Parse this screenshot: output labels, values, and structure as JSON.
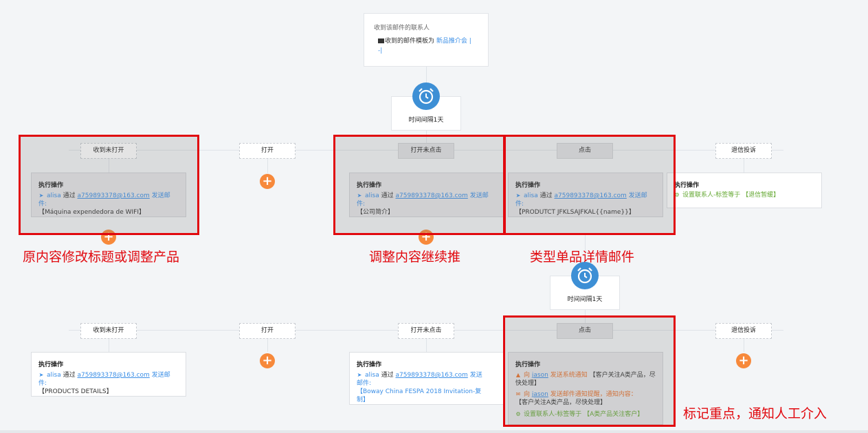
{
  "start": {
    "title": "收到该邮件的联系人",
    "template_prefix": "收到的邮件模板为",
    "template_name": "新品推介会 | -|"
  },
  "timers": [
    {
      "label": "时间间隔1天",
      "icon": "alarm-clock-icon"
    },
    {
      "label": "时间间隔1天",
      "icon": "alarm-clock-icon"
    }
  ],
  "row1": {
    "branches": [
      "收到未打开",
      "打开",
      "打开未点击",
      "点击",
      "退信投诉"
    ],
    "actions": [
      {
        "title": "执行操作",
        "user": "alisa",
        "via": "通过",
        "email": "a759893378@163.com",
        "send": "发送邮件:",
        "subject": "【Máquina expendedora de WIFI】"
      },
      {
        "title": "执行操作",
        "user": "alisa",
        "via": "通过",
        "email": "a759893378@163.com",
        "send": "发送邮件:",
        "subject": "【公司简介】"
      },
      {
        "title": "执行操作",
        "user": "alisa",
        "via": "通过",
        "email": "a759893378@163.com",
        "send": "发送邮件:",
        "subject": "【PRODUTCT JFKLSAJFKAL{{name}}】"
      },
      {
        "title": "执行操作",
        "tag_text": "设置联系人-标签等于",
        "tag_value": "【退信暂缓】"
      }
    ]
  },
  "row2": {
    "branches": [
      "收到未打开",
      "打开",
      "打开未点击",
      "点击",
      "退信投诉"
    ],
    "actions": [
      {
        "title": "执行操作",
        "user": "alisa",
        "via": "通过",
        "email": "a759893378@163.com",
        "send": "发送邮件:",
        "subject": "【PRODUCTS DETAILS】"
      },
      {
        "title": "执行操作",
        "user": "alisa",
        "via": "通过",
        "email": "a759893378@163.com",
        "send": "发送邮件:",
        "subject": "【Boway China FESPA 2018 Invitation-复制】"
      },
      {
        "title": "执行操作",
        "n1_to": "向",
        "n1_user": "jason",
        "n1_action": "发送系统通知",
        "n1_content": "【客户关注A类产品，尽快处理】",
        "n2_to": "向",
        "n2_user": "jason",
        "n2_action": "发送邮件通知提醒，通知内容：",
        "n2_content": "【客户关注A类产品，尽快处理】",
        "tag_text": "设置联系人-标签等于",
        "tag_value": "【A类产品关注客户】"
      }
    ]
  },
  "annotations": {
    "a1": "原内容修改标题或调整产品",
    "a2": "调整内容继续推",
    "a3": "类型单品详情邮件",
    "a4": "标记重点，通知人工介入"
  },
  "colors": {
    "accent_blue": "#3d8fd5",
    "link_blue": "#3a8ee6",
    "plus_orange": "#f7893b",
    "annotation_red": "#e1080e",
    "tag_green": "#64a832",
    "notify_orange": "#e8722e"
  }
}
